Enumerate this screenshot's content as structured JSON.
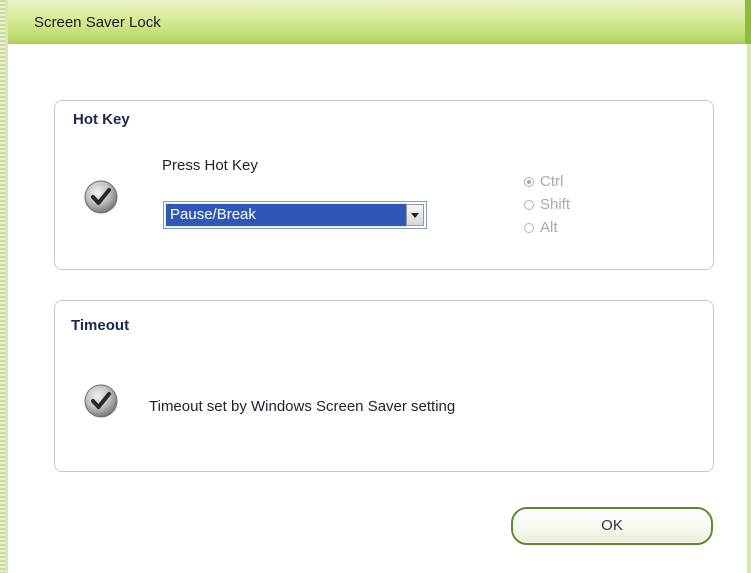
{
  "window": {
    "title": "Screen Saver Lock"
  },
  "hotkey": {
    "title": "Hot Key",
    "press_label": "Press Hot Key",
    "selected_key": "Pause/Break",
    "modifiers": [
      {
        "label": "Ctrl",
        "checked": true
      },
      {
        "label": "Shift",
        "checked": false
      },
      {
        "label": "Alt",
        "checked": false
      }
    ]
  },
  "timeout": {
    "title": "Timeout",
    "description": "Timeout set by Windows Screen Saver setting"
  },
  "buttons": {
    "ok_label": "OK"
  },
  "colors": {
    "titlebar_green": "#c6e07a",
    "selection_blue": "#2f57b8",
    "button_border": "#5d8a2c",
    "disabled_text": "#a9a9a9"
  },
  "icons": {
    "status": "check-circle-icon",
    "dropdown": "chevron-down-icon"
  }
}
